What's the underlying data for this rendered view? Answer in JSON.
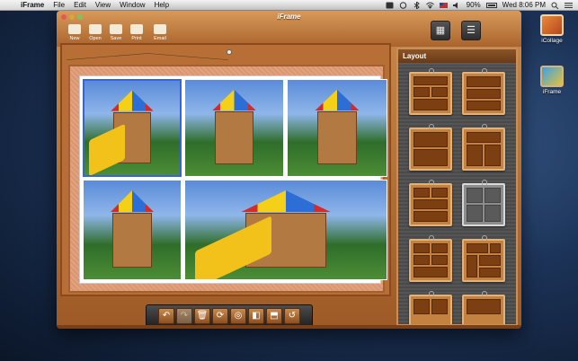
{
  "menubar": {
    "app_name": "iFrame",
    "items": [
      "File",
      "Edit",
      "View",
      "Window",
      "Help"
    ],
    "battery": "90%",
    "clock": "Wed 8:06 PM"
  },
  "desktop": {
    "icons": [
      {
        "label": "iCollage",
        "icon": "icollage-app-icon"
      },
      {
        "label": "iFrame",
        "icon": "iframe-app-icon"
      }
    ]
  },
  "window": {
    "title": "iFrame",
    "toolbar": {
      "new_label": "New",
      "open_label": "Open",
      "save_label": "Save",
      "print_label": "Print",
      "email_label": "Email"
    }
  },
  "layout_panel": {
    "title": "Layout",
    "selected_index": 5
  },
  "colors": {
    "wood": "#b86f36",
    "panel": "#5a5a5a",
    "selection": "#3a62d8"
  }
}
